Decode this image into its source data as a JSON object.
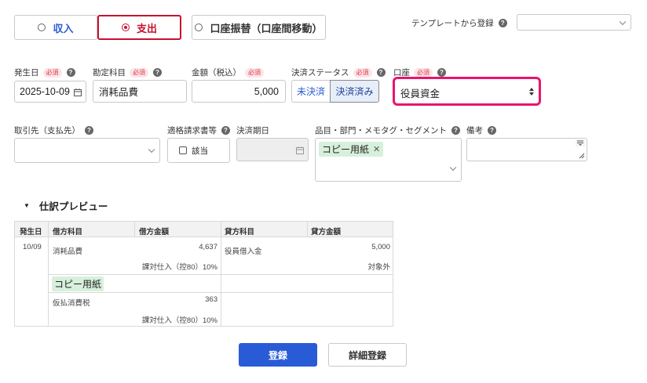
{
  "type_tabs": [
    {
      "label": "収入"
    },
    {
      "label": "支出"
    },
    {
      "label": "口座振替（口座間移動）"
    }
  ],
  "template": {
    "label": "テンプレートから登録",
    "value": ""
  },
  "fields": {
    "date": {
      "label": "発生日",
      "required": "必須",
      "value": "2025-10-09"
    },
    "account": {
      "label": "勘定科目",
      "required": "必須",
      "value": "消耗品費"
    },
    "amount": {
      "label": "金額（税込）",
      "required": "必須",
      "value": "5,000"
    },
    "status": {
      "label": "決済ステータス",
      "required": "必須",
      "options": [
        "未決済",
        "決済済み"
      ],
      "selected": "決済済み"
    },
    "wallet": {
      "label": "口座",
      "required": "必須",
      "value": "役員資金"
    },
    "partner": {
      "label": "取引先（支払先）",
      "value": ""
    },
    "invoice": {
      "label": "適格請求書等",
      "checkbox_label": "該当"
    },
    "due": {
      "label": "決済期日",
      "value": ""
    },
    "tags": {
      "label": "品目・部門・メモタグ・セグメント",
      "chips": [
        "コピー用紙"
      ]
    },
    "note": {
      "label": "備考",
      "value": ""
    }
  },
  "preview": {
    "title": "仕訳プレビュー",
    "headers": [
      "発生日",
      "借方科目",
      "借方金額",
      "貸方科目",
      "貸方金額"
    ],
    "date": "10/09",
    "rows": [
      {
        "debit_account": "消耗品費",
        "debit_amount": "4,637",
        "debit_tax": "課対仕入（控80）10%",
        "credit_account": "役員借入金",
        "credit_amount": "5,000",
        "credit_tax": "対象外"
      },
      {
        "tag": "コピー用紙"
      },
      {
        "debit_account": "仮払消費税",
        "debit_amount": "363",
        "debit_tax": "課対仕入（控80）10%"
      }
    ]
  },
  "buttons": {
    "register": "登録",
    "detail": "詳細登録"
  },
  "colors": {
    "accent_red": "#c8102e",
    "highlight_pink": "#e8156e",
    "primary_blue": "#2a5bd7",
    "tag_green": "#d7f0dc"
  }
}
